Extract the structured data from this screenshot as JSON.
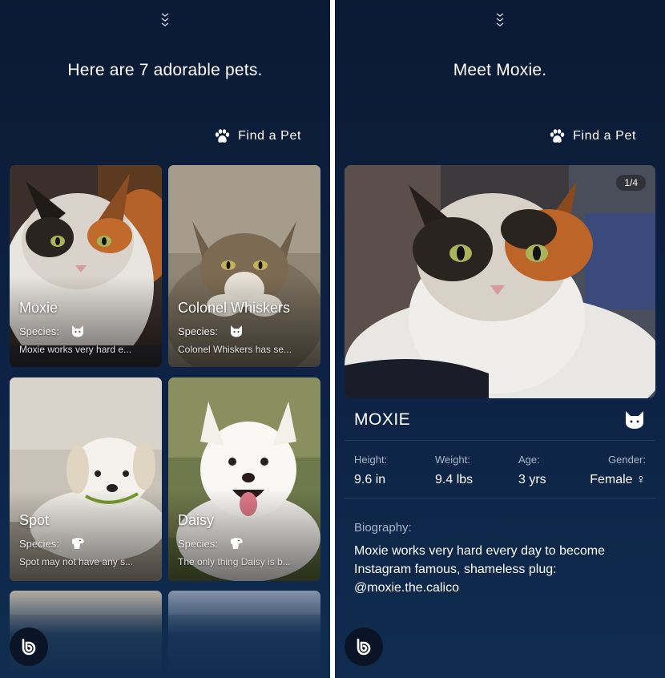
{
  "list_screen": {
    "headline": "Here are 7 adorable pets.",
    "find_pet_label": "Find a Pet",
    "species_label": "Species:",
    "pets": [
      {
        "name": "Moxie",
        "species_icon": "cat-icon",
        "desc": "Moxie works very hard e..."
      },
      {
        "name": "Colonel Whiskers",
        "species_icon": "cat-icon",
        "desc": "Colonel Whiskers has se..."
      },
      {
        "name": "Spot",
        "species_icon": "dog-icon",
        "desc": "Spot may not have any s..."
      },
      {
        "name": "Daisy",
        "species_icon": "dog-icon",
        "desc": "The only thing Daisy is b..."
      }
    ]
  },
  "detail_screen": {
    "headline": "Meet Moxie.",
    "find_pet_label": "Find a Pet",
    "photo_counter": "1/4",
    "pet_name": "MOXIE",
    "stats": [
      {
        "label": "Height:",
        "value": "9.6 in"
      },
      {
        "label": "Weight:",
        "value": "9.4 lbs"
      },
      {
        "label": "Age:",
        "value": "3 yrs"
      },
      {
        "label": "Gender:",
        "value": "Female ♀"
      }
    ],
    "biography_label": "Biography:",
    "biography": "Moxie works very hard every day to become Instagram famous, shameless plug: @moxie.the.calico"
  },
  "colors": {
    "background_top": "#0b1a33",
    "background_bottom": "#0f2c4f",
    "muted_label": "#aab6c8"
  }
}
